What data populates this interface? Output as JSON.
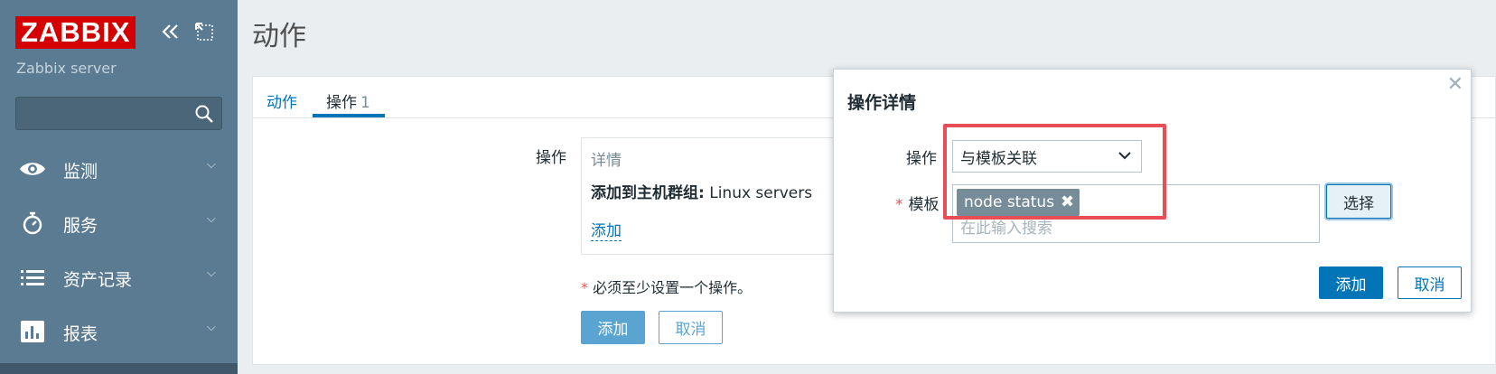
{
  "sidebar": {
    "logo": "ZABBIX",
    "server_name": "Zabbix server",
    "search_placeholder": "",
    "items": [
      {
        "label": "监测",
        "icon": "eye-icon"
      },
      {
        "label": "服务",
        "icon": "stopwatch-icon"
      },
      {
        "label": "资产记录",
        "icon": "list-icon"
      },
      {
        "label": "报表",
        "icon": "bar-chart-icon"
      }
    ]
  },
  "page": {
    "title": "动作"
  },
  "tabs": {
    "action": "动作",
    "operations": "操作",
    "operations_count": "1"
  },
  "form": {
    "operations_label": "操作",
    "details_header": "详情",
    "op_row_bold": "添加到主机群组:",
    "op_row_value": "Linux servers",
    "add_link": "添加",
    "required_note": "必须至少设置一个操作。",
    "add_button": "添加",
    "cancel_button": "取消"
  },
  "modal": {
    "title": "操作详情",
    "operation_label": "操作",
    "operation_value": "与模板关联",
    "template_label": "模板",
    "template_tag": "node status",
    "search_placeholder": "在此输入搜索",
    "select_button": "选择",
    "add_button": "添加",
    "cancel_button": "取消"
  },
  "colors": {
    "sidebar": "#5a7b91",
    "brand": "#d40000",
    "accent": "#0275b8",
    "highlight": "#e84e55"
  }
}
